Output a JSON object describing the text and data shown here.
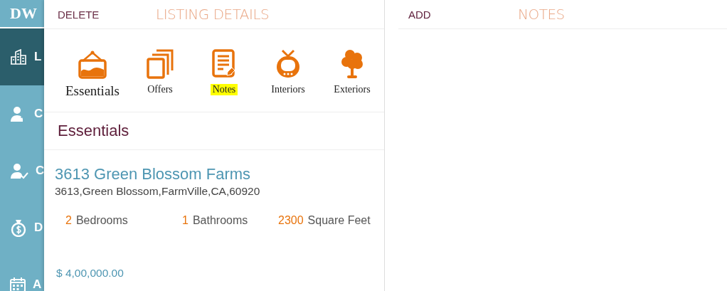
{
  "sidebar": {
    "logo": "DW",
    "items": [
      {
        "label": "L",
        "selected": true
      },
      {
        "label": "C",
        "selected": false
      },
      {
        "label": "C",
        "selected": false
      },
      {
        "label": "D",
        "selected": false
      },
      {
        "label": "A",
        "selected": false
      }
    ]
  },
  "details": {
    "action": "DELETE",
    "title": "LISTING DETAILS",
    "tabs": [
      {
        "label": "Essentials",
        "selected": true,
        "highlighted": false
      },
      {
        "label": "Offers",
        "selected": false,
        "highlighted": false
      },
      {
        "label": "Notes",
        "selected": false,
        "highlighted": true
      },
      {
        "label": "Interiors",
        "selected": false,
        "highlighted": false
      },
      {
        "label": "Exteriors",
        "selected": false,
        "highlighted": false
      }
    ],
    "section": "Essentials",
    "listing": {
      "name": "3613 Green Blossom Farms",
      "address": "3613,Green Blossom,FarmVille,CA,60920",
      "stats": [
        {
          "value": "2",
          "label": "Bedrooms"
        },
        {
          "value": "1",
          "label": "Bathrooms"
        },
        {
          "value": "2300",
          "label": "Square Feet"
        }
      ],
      "price": "$ 4,00,000.00"
    }
  },
  "notes": {
    "action": "ADD",
    "title": "NOTES"
  }
}
